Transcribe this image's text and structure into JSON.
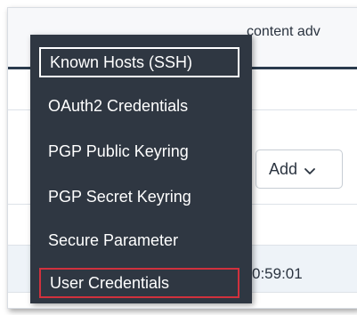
{
  "background": {
    "topbar_text": "content adv",
    "add_button_label": "Add",
    "time_text": "0:59:01"
  },
  "menu": {
    "items": [
      {
        "label": "Known Hosts (SSH)"
      },
      {
        "label": "OAuth2 Credentials"
      },
      {
        "label": "PGP Public Keyring"
      },
      {
        "label": "PGP Secret Keyring"
      },
      {
        "label": "Secure Parameter"
      },
      {
        "label": "User Credentials"
      }
    ]
  },
  "colors": {
    "menu_background": "#2f3742",
    "menu_text": "#ffffff",
    "selected_highlight": "#d1313d",
    "header_accent": "#2a3b4d"
  },
  "icons": {
    "add_dropdown": "chevron-down-icon"
  }
}
